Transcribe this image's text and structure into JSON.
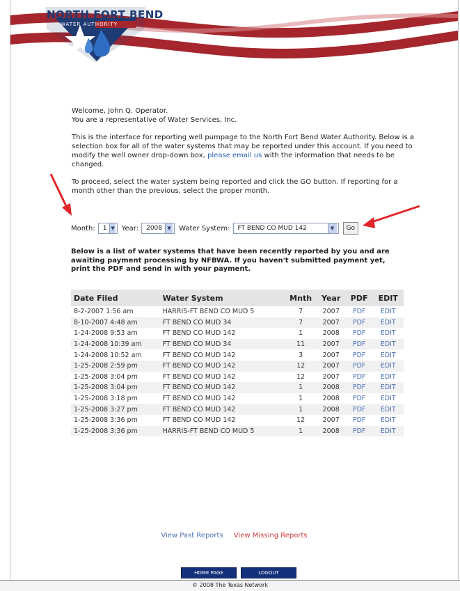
{
  "logo": {
    "title": "NORTH FORT BEND",
    "subtitle": "WATER AUTHORITY"
  },
  "welcome": {
    "line1": "Welcome, John Q. Operator.",
    "line2": "You are a representative of Water Services, Inc."
  },
  "intro": {
    "text_before_link": "This is the interface for reporting well pumpage to the North Fort Bend Water Authority. Below is a selection box for all of the water systems that may be reported under this account. If you need to modify the well owner drop-down box, ",
    "link": "please email us",
    "text_after_link": " with the information that needs to be changed."
  },
  "proceed_text": "To proceed, select the water system being reported and click the GO button. If reporting for a month other than the previous, select the proper month.",
  "controls": {
    "month_label": "Month:",
    "month_value": "1",
    "year_label": "Year:",
    "year_value": "2008",
    "system_label": "Water System:",
    "system_value": "FT BEND CO MUD 142",
    "go_label": "Go"
  },
  "notice": "Below is a list of water systems that have been recently reported by you and are awaiting payment processing by NFBWA. If you haven't submitted payment yet, print the PDF and send in with your payment.",
  "table": {
    "headers": [
      "Date Filed",
      "Water System",
      "Mnth",
      "Year",
      "PDF",
      "EDIT"
    ],
    "rows": [
      [
        "8-2-2007 1:56 am",
        "HARRIS-FT BEND CO MUD 5",
        "7",
        "2007",
        "PDF",
        "EDIT"
      ],
      [
        "8-10-2007 4:48 am",
        "FT BEND CO MUD 34",
        "7",
        "2007",
        "PDF",
        "EDIT"
      ],
      [
        "1-24-2008 9:53 am",
        "FT BEND CO MUD 142",
        "1",
        "2008",
        "PDF",
        "EDIT"
      ],
      [
        "1-24-2008 10:39 am",
        "FT BEND CO MUD 34",
        "11",
        "2007",
        "PDF",
        "EDIT"
      ],
      [
        "1-24-2008 10:52 am",
        "FT BEND CO MUD 142",
        "3",
        "2007",
        "PDF",
        "EDIT"
      ],
      [
        "1-25-2008 2:59 pm",
        "FT BEND CO MUD 142",
        "12",
        "2007",
        "PDF",
        "EDIT"
      ],
      [
        "1-25-2008 3:04 pm",
        "FT BEND CO MUD 142",
        "12",
        "2007",
        "PDF",
        "EDIT"
      ],
      [
        "1-25-2008 3:04 pm",
        "FT BEND CO MUD 142",
        "1",
        "2008",
        "PDF",
        "EDIT"
      ],
      [
        "1-25-2008 3:18 pm",
        "FT BEND CO MUD 142",
        "1",
        "2008",
        "PDF",
        "EDIT"
      ],
      [
        "1-25-2008 3:27 pm",
        "FT BEND CO MUD 142",
        "1",
        "2008",
        "PDF",
        "EDIT"
      ],
      [
        "1-25-2008 3:36 pm",
        "FT BEND CO MUD 142",
        "12",
        "2007",
        "PDF",
        "EDIT"
      ],
      [
        "1-25-2008 3:36 pm",
        "HARRIS-FT BEND CO MUD 5",
        "1",
        "2008",
        "PDF",
        "EDIT"
      ]
    ]
  },
  "links": {
    "past": "View Past Reports",
    "missing": "View Missing Reports"
  },
  "nav": {
    "home": "HOME PAGE",
    "logout": "LOGOUT"
  },
  "footer": "© 2008 The Texas Network",
  "colors": {
    "stripe_red": "#a5262c",
    "navy": "#13307a",
    "link_blue": "#4a6fb5",
    "missing_red": "#d23a3a"
  }
}
